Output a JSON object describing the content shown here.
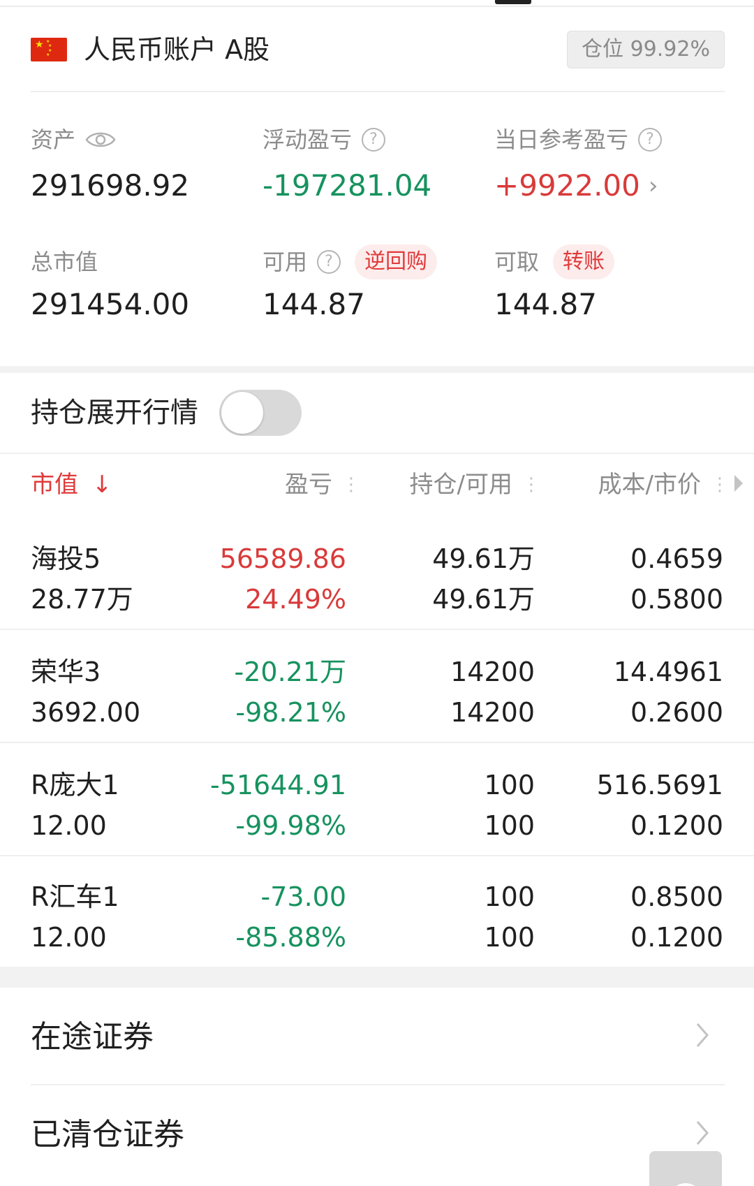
{
  "account": {
    "title": "人民币账户 A股",
    "position_badge": "仓位 99.92%"
  },
  "stats": {
    "assets_label": "资产",
    "assets_value": "291698.92",
    "floating_pl_label": "浮动盈亏",
    "floating_pl_value": "-197281.04",
    "daily_pl_label": "当日参考盈亏",
    "daily_pl_value": "+9922.00",
    "market_value_label": "总市值",
    "market_value_value": "291454.00",
    "available_label": "可用",
    "available_value": "144.87",
    "reverse_repo_label": "逆回购",
    "withdrawable_label": "可取",
    "withdrawable_value": "144.87",
    "transfer_label": "转账",
    "help_glyph": "?"
  },
  "toggle": {
    "label": "持仓展开行情",
    "on": false
  },
  "table": {
    "headers": {
      "market_value": "市值",
      "pl": "盈亏",
      "hold_avail": "持仓/可用",
      "cost_price": "成本/市价"
    },
    "rows": [
      {
        "name": "海投5",
        "market_value": "28.77万",
        "pl": "56589.86",
        "pl_pct": "24.49%",
        "hold": "49.61万",
        "avail": "49.61万",
        "cost": "0.4659",
        "price": "0.5800",
        "pl_color": "#d93a3a"
      },
      {
        "name": "荣华3",
        "market_value": "3692.00",
        "pl": "-20.21万",
        "pl_pct": "-98.21%",
        "hold": "14200",
        "avail": "14200",
        "cost": "14.4961",
        "price": "0.2600",
        "pl_color": "#17925f"
      },
      {
        "name": "R庞大1",
        "market_value": "12.00",
        "pl": "-51644.91",
        "pl_pct": "-99.98%",
        "hold": "100",
        "avail": "100",
        "cost": "516.5691",
        "price": "0.1200",
        "pl_color": "#17925f"
      },
      {
        "name": "R汇车1",
        "market_value": "12.00",
        "pl": "-73.00",
        "pl_pct": "-85.88%",
        "hold": "100",
        "avail": "100",
        "cost": "0.8500",
        "price": "0.1200",
        "pl_color": "#17925f"
      }
    ]
  },
  "lists": {
    "in_transit": "在途证券",
    "cleared": "已清仓证券"
  },
  "colors": {
    "up": "#d93a3a",
    "down": "#17925f",
    "accent": "#e03a3a"
  },
  "icons": {
    "flag": "china-flag-icon",
    "eye": "eye-icon",
    "help": "question-circle-icon",
    "sort": "arrow-down-icon",
    "more": "kebab-icon",
    "chevron": "chevron-right-icon"
  }
}
